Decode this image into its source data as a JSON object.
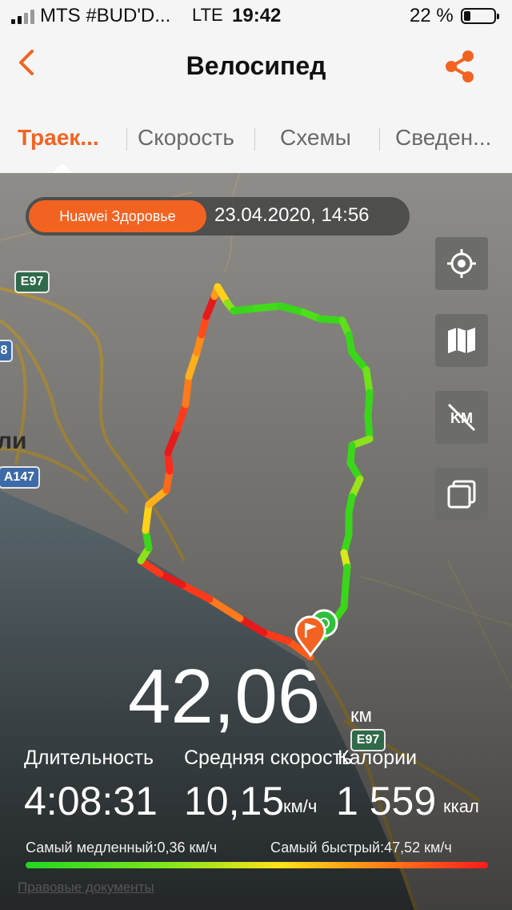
{
  "status_bar": {
    "carrier": "MTS #BUD'D...",
    "network": "LTE",
    "time": "19:42",
    "battery_percent_label": "22 %",
    "battery_level": 0.22
  },
  "header": {
    "title": "Велосипед",
    "back_icon": "chevron-left-icon",
    "share_icon": "share-icon",
    "accent_color": "#f26322"
  },
  "tabs": [
    {
      "label": "Траек...",
      "active": true
    },
    {
      "label": "Скорость",
      "active": false
    },
    {
      "label": "Схемы",
      "active": false
    },
    {
      "label": "Сведен...",
      "active": false
    }
  ],
  "map": {
    "source": "Huawei Здоровье",
    "datetime": "23.04.2020, 14:56",
    "road_labels": [
      "E97",
      "A147",
      "8",
      "E97"
    ],
    "city_fragment": "ли",
    "buttons": [
      "locate-icon",
      "map-type-icon",
      "km-markers-off-icon",
      "layers-icon"
    ]
  },
  "stats": {
    "distance": "42,06",
    "distance_unit": "км",
    "duration_label": "Длительность",
    "duration_value": "4:08:31",
    "avg_speed_label": "Средняя скорость",
    "avg_speed_value": "10,15",
    "avg_speed_unit": "км/ч",
    "calories_label": "Калории",
    "calories_value": "1 559",
    "calories_unit": "ккал",
    "slowest": "Самый медленный:0,36 км/ч",
    "fastest": "Самый быстрый:47,52 км/ч"
  },
  "footer": {
    "legal_link": "Правовые документы"
  }
}
